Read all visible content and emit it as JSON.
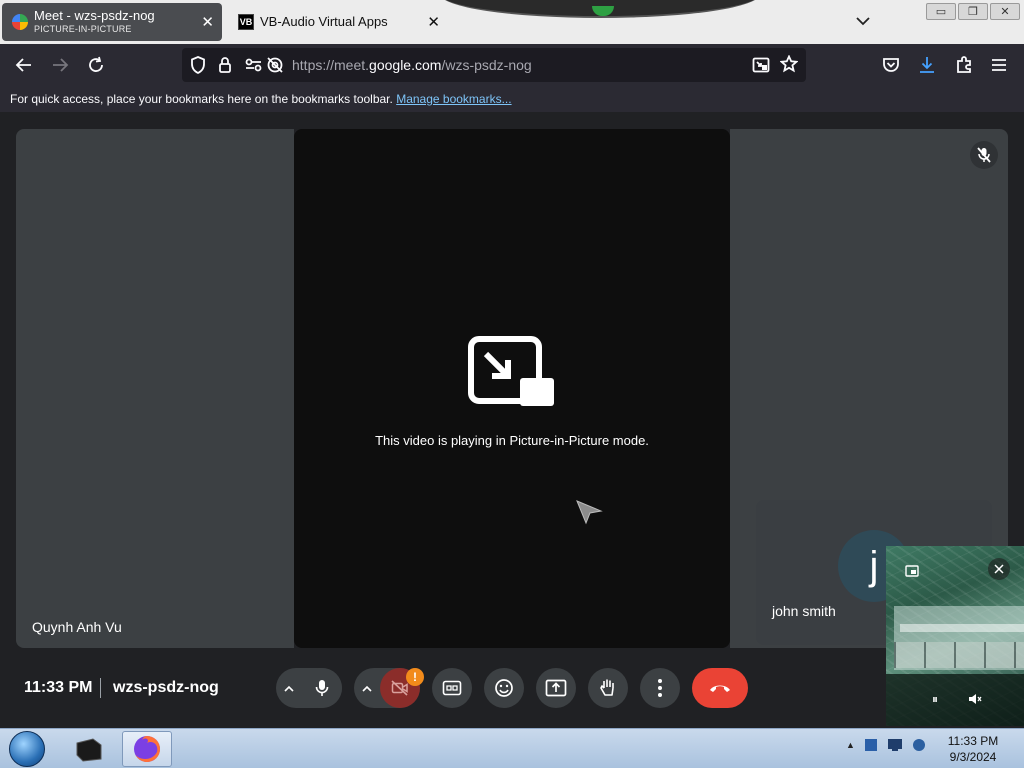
{
  "tabs": [
    {
      "title": "Meet - wzs-psdz-nog",
      "subtitle": "PICTURE-IN-PICTURE",
      "close": "✕",
      "active": true
    },
    {
      "title": "VB-Audio Virtual Apps",
      "favicon_text": "VB",
      "close": "✕",
      "active": false
    }
  ],
  "window_controls": {
    "minimize": "▭",
    "restore": "❐",
    "close": "✕"
  },
  "urlbar": {
    "prefix": "https://meet.",
    "domain": "google.com",
    "path": "/wzs-psdz-nog"
  },
  "bookmarks_bar": {
    "message": "For quick access, place your bookmarks here on the bookmarks toolbar.",
    "link": "Manage bookmarks..."
  },
  "meet": {
    "participants": [
      {
        "name": "Quynh Anh Vu"
      },
      {
        "name": "john smith",
        "avatar_letter": "j"
      }
    ],
    "pip_message": "This video is playing in Picture-in-Picture mode.",
    "time": "11:33 PM",
    "meeting_code": "wzs-psdz-nog",
    "camera_warning": "!"
  },
  "pip_window": {
    "pause": "⏸"
  },
  "taskbar": {
    "time": "11:33 PM",
    "date": "9/3/2024"
  },
  "colors": {
    "end_call": "#ea4335",
    "link": "#7ec4f8",
    "warning": "#f28b1b"
  }
}
